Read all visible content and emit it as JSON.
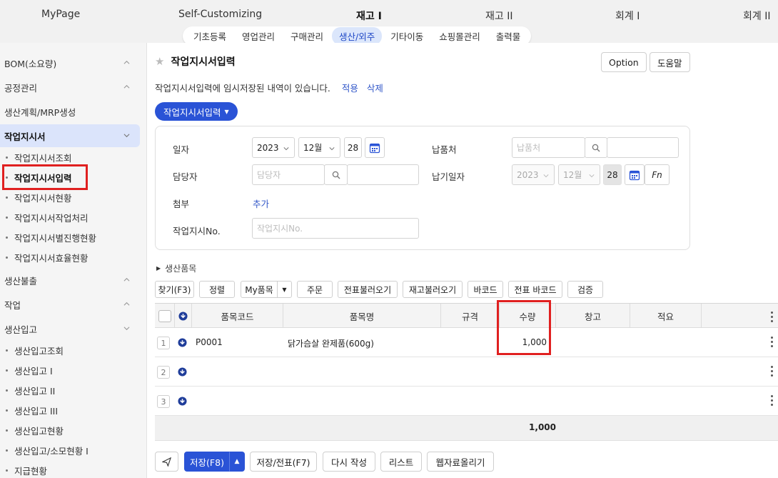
{
  "topnav": {
    "items": [
      "MyPage",
      "Self-Customizing",
      "재고 I",
      "재고 II",
      "회계 I",
      "회계 II"
    ],
    "active": "재고 I"
  },
  "subnav": {
    "items": [
      "기초등록",
      "영업관리",
      "구매관리",
      "생산/외주",
      "기타이동",
      "쇼핑몰관리",
      "출력물"
    ],
    "active": "생산/외주"
  },
  "sidebar": {
    "sections": [
      {
        "label": "BOM(소요량)"
      },
      {
        "label": "공정관리"
      },
      {
        "label": "생산계획/MRP생성"
      },
      {
        "label": "작업지시서"
      },
      {
        "label": "생산불출"
      },
      {
        "label": "작업"
      },
      {
        "label": "생산입고"
      }
    ],
    "work_order_items": [
      "작업지시서조회",
      "작업지시서입력",
      "작업지시서현황",
      "작업지시서작업처리",
      "작업지시서별진행현황",
      "작업지시서효율현황"
    ],
    "production_items": [
      "생산입고조회",
      "생산입고 I",
      "생산입고 II",
      "생산입고 III",
      "생산입고현황",
      "생산입고/소모현황 I",
      "지급현황"
    ]
  },
  "page": {
    "title": "작업지시서입력",
    "option_btn": "Option",
    "help_btn": "도움말",
    "notice": "작업지시서입력에 임시저장된 내역이 있습니다.",
    "apply_link": "적용",
    "delete_link": "삭제",
    "dropdown_btn": "작업지시서입력"
  },
  "form": {
    "date_label": "일자",
    "year": "2023",
    "month": "12월",
    "day": "28",
    "vendor_label": "납품처",
    "vendor_placeholder": "납품처",
    "manager_label": "담당자",
    "manager_placeholder": "담당자",
    "due_label": "납기일자",
    "due_year": "2023",
    "due_month": "12월",
    "due_day": "28",
    "fn_label": "Fn",
    "attach_label": "첨부",
    "attach_add": "추가",
    "order_no_label": "작업지시No.",
    "order_no_placeholder": "작업지시No."
  },
  "section_label": "생산품목",
  "toolbar": {
    "buttons": [
      "찾기(F3)",
      "정렬",
      "My품목",
      "주문",
      "전표불러오기",
      "재고불러오기",
      "바코드",
      "전표 바코드",
      "검증"
    ]
  },
  "grid": {
    "columns": [
      "품목코드",
      "품목명",
      "규격",
      "수량",
      "창고",
      "적요"
    ],
    "rows": [
      {
        "num": "1",
        "code": "P0001",
        "name": "닭가슴살 완제품(600g)",
        "spec": "",
        "qty": "1,000",
        "warehouse": "",
        "memo": ""
      },
      {
        "num": "2",
        "code": "",
        "name": "",
        "spec": "",
        "qty": "",
        "warehouse": "",
        "memo": ""
      },
      {
        "num": "3",
        "code": "",
        "name": "",
        "spec": "",
        "qty": "",
        "warehouse": "",
        "memo": ""
      }
    ],
    "total_qty": "1,000"
  },
  "bottom": {
    "save": "저장(F8)",
    "save_slip": "저장/전표(F7)",
    "rewrite": "다시 작성",
    "list": "리스트",
    "upload": "웹자료올리기"
  },
  "colors": {
    "accent": "#2a53d6",
    "highlight_box": "#e02020",
    "sidebar_active": "#dbe4fb"
  }
}
